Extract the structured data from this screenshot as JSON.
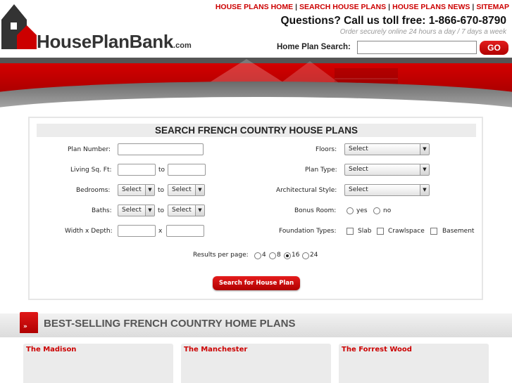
{
  "brand": {
    "name_main": "HousePlanBank",
    "name_suffix": ".com"
  },
  "topnav": [
    "HOUSE PLANS HOME",
    "SEARCH HOUSE PLANS",
    "HOUSE PLANS NEWS",
    "SITEMAP"
  ],
  "contact": {
    "phone_text": "Questions? Call us toll free:  1-866-670-8790",
    "tagline": "Order securely online 24 hours a day / 7 days a week"
  },
  "site_search": {
    "label": "Home Plan Search:",
    "value": "",
    "button": "GO"
  },
  "search_form": {
    "title": "SEARCH FRENCH COUNTRY HOUSE PLANS",
    "plan_number_label": "Plan Number:",
    "living_sqft_label": "Living Sq. Ft:",
    "bedrooms_label": "Bedrooms:",
    "baths_label": "Baths:",
    "width_depth_label": "Width x Depth:",
    "to": "to",
    "times": "x",
    "select_text": "Select",
    "floors_label": "Floors:",
    "plan_type_label": "Plan Type:",
    "arch_style_label": "Architectural Style:",
    "bonus_room_label": "Bonus Room:",
    "bonus_options": [
      "yes",
      "no"
    ],
    "foundation_label": "Foundation Types:",
    "foundation_options": [
      "Slab",
      "Crawlspace",
      "Basement"
    ],
    "results_label": "Results per page:",
    "results_options": [
      "4",
      "8",
      "16",
      "24"
    ],
    "results_selected": "16",
    "submit": "Search for House Plan"
  },
  "best_selling": {
    "tab_glyph": "»",
    "title": "BEST-SELLING FRENCH COUNTRY HOME PLANS",
    "cards": [
      "The Madison",
      "The Manchester",
      "The Forrest Wood"
    ]
  },
  "colors": {
    "brand_red": "#cc0000",
    "button_red": "#c80000",
    "panel_border": "#e6e6e6"
  }
}
